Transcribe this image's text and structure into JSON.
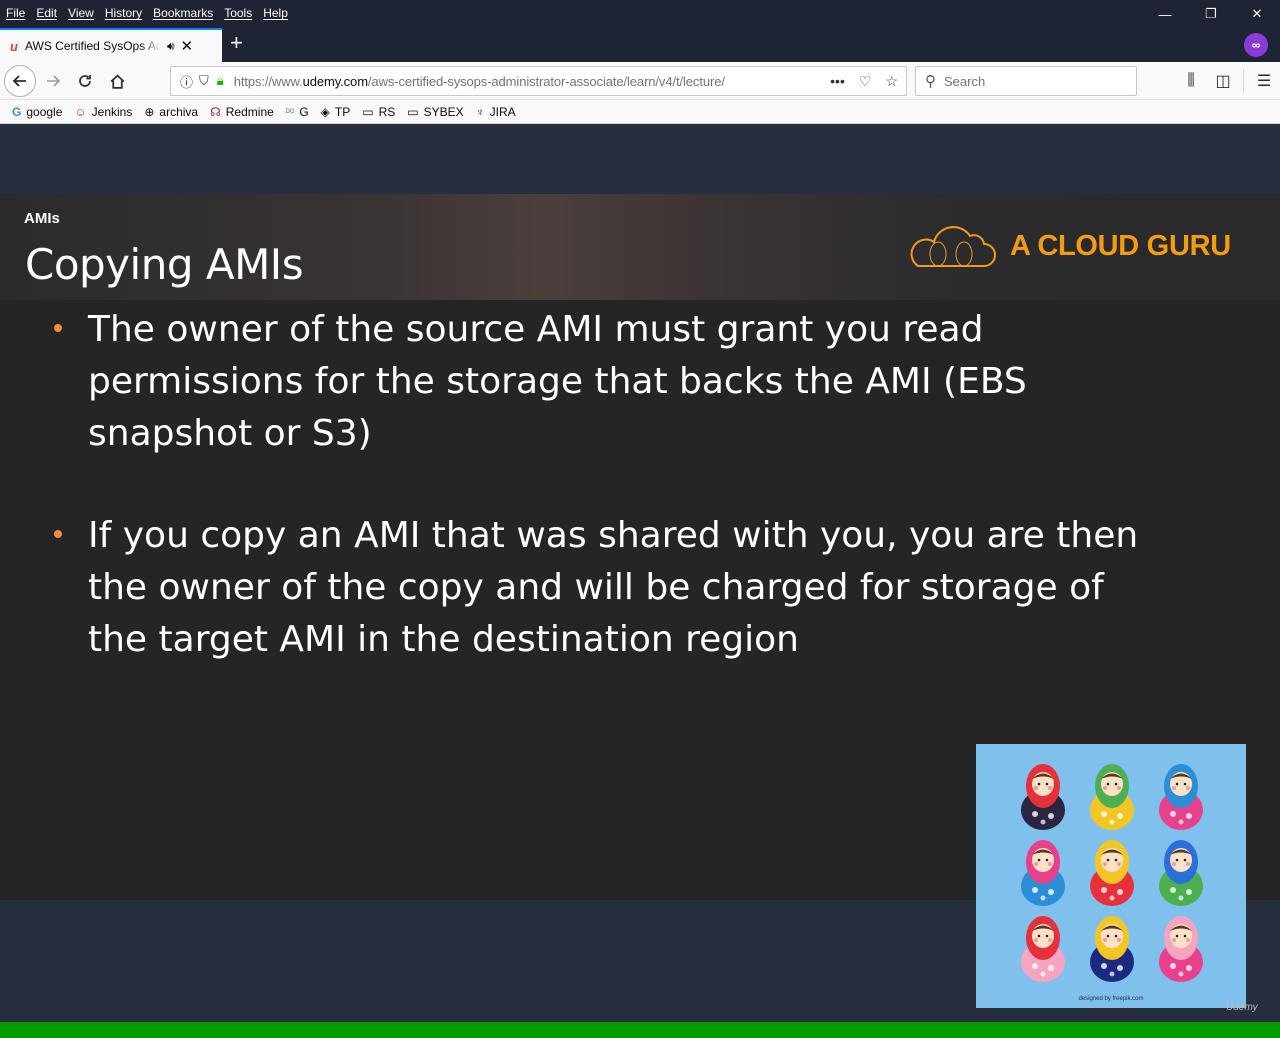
{
  "menubar": {
    "items": [
      "File",
      "Edit",
      "View",
      "History",
      "Bookmarks",
      "Tools",
      "Help"
    ]
  },
  "window_controls": {
    "minimize": "—",
    "restore": "❐",
    "close": "✕"
  },
  "tab": {
    "favicon": "u",
    "title": "AWS Certified SysOps Administrator",
    "audio_icon": "speaker-icon",
    "close_icon": "close-icon"
  },
  "new_tab": "+",
  "urlbar": {
    "prefix": "https://www.",
    "domain": "udemy.com",
    "path": "/aws-certified-sysops-administrator-associate/learn/v4/t/lecture/"
  },
  "search": {
    "placeholder": "Search"
  },
  "bookmarks": [
    {
      "label": "google",
      "icon": "G"
    },
    {
      "label": "Jenkins",
      "icon": "☺"
    },
    {
      "label": "archiva",
      "icon": "⊕"
    },
    {
      "label": "Redmine",
      "icon": "☊"
    },
    {
      "label": "G",
      "icon": "ᴰᴳ"
    },
    {
      "label": "TP",
      "icon": "◈"
    },
    {
      "label": "RS",
      "icon": "▭"
    },
    {
      "label": "SYBEX",
      "icon": "▭"
    },
    {
      "label": "JIRA",
      "icon": "♆"
    }
  ],
  "slide": {
    "section": "AMIs",
    "title": "Copying AMIs",
    "brand": "A CLOUD GURU",
    "bullets": [
      "The owner of the source AMI must grant you read permissions for the storage that backs the AMI (EBS snapshot or S3)",
      "If you copy an AMI that was shared with you, you are then the owner of the copy and will be charged for storage of the target AMI in the destination region"
    ],
    "image_credit": "designed by freepik.com",
    "watermark": "Udemy"
  },
  "colors": {
    "accent_orange": "#f39c12",
    "bullet_dot": "#f38b3c",
    "progress_green": "#029b02",
    "doll_bg": "#7fc0ed"
  }
}
